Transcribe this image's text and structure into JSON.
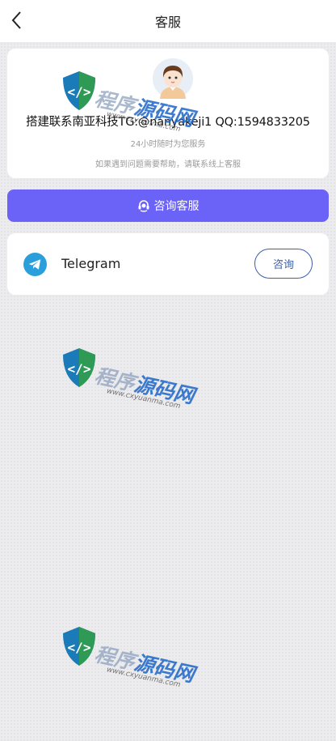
{
  "header": {
    "title": "客服"
  },
  "profile": {
    "contact": "搭建联系南亚科技TG:@nanyakeji1 QQ:1594833205",
    "hours": "24小时随时为您服务",
    "help": "如果遇到问题需要帮助，请联系线上客服"
  },
  "consult_button": {
    "label": "咨询客服"
  },
  "channels": [
    {
      "name": "Telegram",
      "action_label": "咨询",
      "icon": "telegram-icon"
    }
  ],
  "watermark": {
    "brand_gray": "程序",
    "brand_blue": "源码网",
    "url": "www.cxyuanma.com"
  },
  "colors": {
    "accent": "#6b63f7",
    "telegram": "#2a9fdc",
    "button_outline": "#3f5fa8"
  }
}
